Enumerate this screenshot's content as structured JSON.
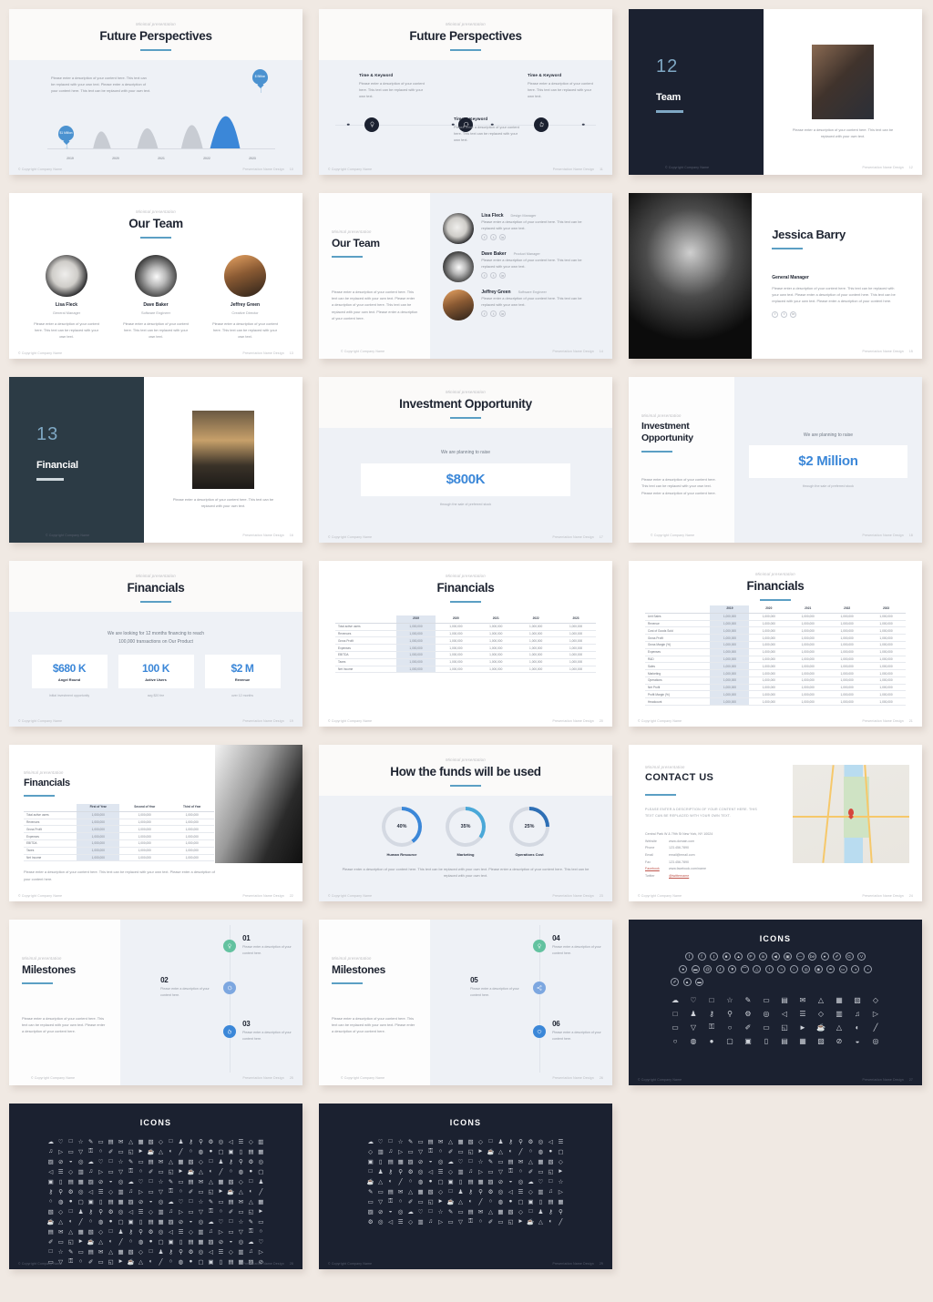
{
  "common": {
    "eyebrow": "Minimal presentation",
    "copyright": "© Copyright Company Name",
    "footer_right": "Presentation Name Design",
    "lorem_short": "Please enter a description of your content here. This text can be replaced with your own text.",
    "lorem_long": "Please enter a description of your content here. This text can be replaced with your own text. Please enter a description of your content here. This text can be replaced with your own text.",
    "lorem_xl": "Please enter a description of your content here. This text can be replaced with your own text. Please enter a description of your content here. This text can be replaced with your own text. Please enter a description of your content here."
  },
  "slides": [
    {
      "id": "future-perspectives-chart",
      "eyebrow": "Minimal presentation",
      "title": "Future Perspectives",
      "desc": "Please enter a description of your content here. This text can be replaced with your own text. Please enter a description of your content here. This text can be replaced with your own text.",
      "page": "10"
    },
    {
      "id": "future-perspectives-timeline",
      "eyebrow": "Minimal presentation",
      "title": "Future Perspectives",
      "items": [
        {
          "heading": "Time & Keyword",
          "text": "Please enter a description of your content here. This text can be replaced with your own text.",
          "icon": "lightbulb-icon",
          "glyph": "☀"
        },
        {
          "heading": "Time & Keyword",
          "text": "Please enter a description of your content here. This text can be replaced with your own text.",
          "icon": "chat-bubble-icon",
          "glyph": "●"
        },
        {
          "heading": "Time & Keyword",
          "text": "Please enter a description of your content here. This text can be replaced with your own text.",
          "icon": "thumbs-up-icon",
          "glyph": "☝"
        }
      ],
      "page": "11"
    },
    {
      "id": "section-team",
      "number": "12",
      "title": "Team",
      "caption": "Please enter a description of your content here. This text can be replaced with your own text.",
      "page": "12"
    },
    {
      "id": "our-team-three-up",
      "eyebrow": "Minimal presentation",
      "title": "Our Team",
      "members": [
        {
          "name": "Lisa Fleck",
          "role": "General Manager",
          "bio": "Please enter a description of your content here. This text can be replaced with your own text."
        },
        {
          "name": "Dave Baker",
          "role": "Software Engineer",
          "bio": "Please enter a description of your content here. This text can be replaced with your own text."
        },
        {
          "name": "Jeffrey Green",
          "role": "Creative Director",
          "bio": "Please enter a description of your content here. This text can be replaced with your own text."
        }
      ],
      "page": "13"
    },
    {
      "id": "our-team-list",
      "eyebrow": "Minimal presentation",
      "title": "Our Team",
      "intro": "Please enter a description of your content here. This text can be replaced with your own text. Please enter a description of your content here. This text can be replaced with your own text. Please enter a description of your content here.",
      "members": [
        {
          "name": "Lisa Fleck",
          "role": "Design Manager",
          "bio": "Please enter a description of your content here. This text can be replaced with your own text."
        },
        {
          "name": "Dave Baker",
          "role": "Product Manager",
          "bio": "Please enter a description of your content here. This text can be replaced with your own text."
        },
        {
          "name": "Jeffrey Green",
          "role": "Software Engineer",
          "bio": "Please enter a description of your content here. This text can be replaced with your own text."
        }
      ],
      "socials": [
        "f",
        "t",
        "in"
      ],
      "page": "14"
    },
    {
      "id": "profile-jessica-barry",
      "name": "Jessica Barry",
      "role": "General Manager",
      "bio": "Please enter a description of your content here. This text can be replaced with your own text. Please enter a description of your content here. This text can be replaced with your own text. Please enter a description of your content here.",
      "socials": [
        "f",
        "t",
        "in"
      ],
      "page": "15"
    },
    {
      "id": "section-financial",
      "number": "13",
      "title": "Financial",
      "caption": "Please enter a description of your content here. This text can be replaced with your own text.",
      "page": "16"
    },
    {
      "id": "investment-opportunity-centered",
      "eyebrow": "Minimal presentation",
      "title": "Investment Opportunity",
      "lead": "We are planning to raise",
      "amount": "$800K",
      "sub": "through the sale of preferred stock",
      "page": "17"
    },
    {
      "id": "investment-opportunity-split",
      "eyebrow": "Minimal presentation",
      "title": "Investment Opportunity",
      "intro": "Please enter a description of your content here. This text can be replaced with your own text. Please enter a description of your content here.",
      "lead": "We are planning to raise",
      "amount": "$2 Million",
      "sub": "through the sale of preferred stock",
      "page": "18"
    },
    {
      "id": "financials-kpis",
      "eyebrow": "Minimal presentation",
      "title": "Financials",
      "lead_line1": "We are looking for 12 months financing to reach",
      "lead_line2": "100,000 transactions on Our Product",
      "cards": [
        {
          "value": "$680 K",
          "label": "Angel Round",
          "sub": "Initial investment opportunity"
        },
        {
          "value": "100 K",
          "label": "Active Users",
          "sub": "avg $20 fee"
        },
        {
          "value": "$2 M",
          "label": "Revenue",
          "sub": "over 12 months"
        }
      ],
      "page": "19"
    },
    {
      "id": "financials-table-years",
      "eyebrow": "Minimal presentation",
      "title": "Financials",
      "columns": [
        "",
        "2019",
        "2020",
        "2021",
        "2022",
        "2023"
      ],
      "rows": [
        [
          "Total active users",
          "1,000,000",
          "1,000,000",
          "1,000,000",
          "1,000,000",
          "1,000,000"
        ],
        [
          "Revenues",
          "1,000,000",
          "1,000,000",
          "1,000,000",
          "1,000,000",
          "1,000,000"
        ],
        [
          "Gross Profit",
          "1,000,000",
          "1,000,000",
          "1,000,000",
          "1,000,000",
          "1,000,000"
        ],
        [
          "Expenses",
          "1,000,000",
          "1,000,000",
          "1,000,000",
          "1,000,000",
          "1,000,000"
        ],
        [
          "EBITDA",
          "1,000,000",
          "1,000,000",
          "1,000,000",
          "1,000,000",
          "1,000,000"
        ],
        [
          "Taxes",
          "1,000,000",
          "1,000,000",
          "1,000,000",
          "1,000,000",
          "1,000,000"
        ],
        [
          "Net Income",
          "1,000,000",
          "1,000,000",
          "1,000,000",
          "1,000,000",
          "1,000,000"
        ]
      ],
      "page": "20"
    },
    {
      "id": "financials-table-detailed",
      "eyebrow": "Minimal presentation",
      "title": "Financials",
      "columns": [
        "",
        "2019",
        "2020",
        "2021",
        "2022",
        "2023"
      ],
      "rows": [
        [
          "Unit Sales",
          "1,000,000",
          "1,000,000",
          "1,000,000",
          "1,000,000",
          "1,000,000"
        ],
        [
          "Revenue",
          "1,000,000",
          "1,000,000",
          "1,000,000",
          "1,000,000",
          "1,000,000"
        ],
        [
          "Cost of Goods Sold",
          "1,000,000",
          "1,000,000",
          "1,000,000",
          "1,000,000",
          "1,000,000"
        ],
        [
          "Gross Profit",
          "1,000,000",
          "1,000,000",
          "1,000,000",
          "1,000,000",
          "1,000,000"
        ],
        [
          "Gross Margin (%)",
          "1,000,000",
          "1,000,000",
          "1,000,000",
          "1,000,000",
          "1,000,000"
        ],
        [
          "Expenses",
          "1,000,000",
          "1,000,000",
          "1,000,000",
          "1,000,000",
          "1,000,000"
        ],
        [
          "R&D",
          "1,000,000",
          "1,000,000",
          "1,000,000",
          "1,000,000",
          "1,000,000"
        ],
        [
          "Sales",
          "1,000,000",
          "1,000,000",
          "1,000,000",
          "1,000,000",
          "1,000,000"
        ],
        [
          "Marketing",
          "1,000,000",
          "1,000,000",
          "1,000,000",
          "1,000,000",
          "1,000,000"
        ],
        [
          "Operations",
          "1,000,000",
          "1,000,000",
          "1,000,000",
          "1,000,000",
          "1,000,000"
        ],
        [
          "Net Profit",
          "1,000,000",
          "1,000,000",
          "1,000,000",
          "1,000,000",
          "1,000,000"
        ],
        [
          "Profit Margin (%)",
          "1,000,000",
          "1,000,000",
          "1,000,000",
          "1,000,000",
          "1,000,000"
        ],
        [
          "Headcount",
          "1,000,000",
          "1,000,000",
          "1,000,000",
          "1,000,000",
          "1,000,000"
        ]
      ],
      "page": "21"
    },
    {
      "id": "financials-table-photo",
      "eyebrow": "Minimal presentation",
      "title": "Financials",
      "columns": [
        "",
        "First of Year",
        "Second of Year",
        "Third of Year"
      ],
      "rows": [
        [
          "Total active users",
          "1,000,000",
          "1,000,000",
          "1,000,000"
        ],
        [
          "Revenues",
          "1,000,000",
          "1,000,000",
          "1,000,000"
        ],
        [
          "Gross Profit",
          "1,000,000",
          "1,000,000",
          "1,000,000"
        ],
        [
          "Expenses",
          "1,000,000",
          "1,000,000",
          "1,000,000"
        ],
        [
          "EBITDA",
          "1,000,000",
          "1,000,000",
          "1,000,000"
        ],
        [
          "Taxes",
          "1,000,000",
          "1,000,000",
          "1,000,000"
        ],
        [
          "Net Income",
          "1,000,000",
          "1,000,000",
          "1,000,000"
        ]
      ],
      "note": "Please enter a description of your content here. This text can be replaced with your own text. Please enter a description of your content here.",
      "page": "22"
    },
    {
      "id": "funds-usage",
      "eyebrow": "Minimal presentation",
      "title": "How the funds will be used",
      "note": "Please enter a description of your content here. This text can be replaced with your own text. Please enter a description of your content here. This text can be replaced with your own text.",
      "page": "23"
    },
    {
      "id": "contact-us",
      "eyebrow": "Minimal presentation",
      "title": "CONTACT US",
      "lead": "PLEASE ENTER A DESCRIPTION OF YOUR CONTENT HERE. THIS TEXT CAN BE REPLACED WITH YOUR OWN TEXT.",
      "address": "Central Park W & 79th St New York, NY 10024",
      "fields": [
        {
          "key": "Website",
          "value": "www.domain.com",
          "link": false
        },
        {
          "key": "Phone",
          "value": "123.456.7890",
          "link": false
        },
        {
          "key": "Email",
          "value": "email@email.com",
          "link": false
        },
        {
          "key": "Fax",
          "value": "123.456.7890",
          "link": false
        },
        {
          "key": "Facebook",
          "value": "www.facebook.com/name",
          "link": true
        },
        {
          "key": "Twitter",
          "value": "@twittername",
          "link": true
        }
      ],
      "page": "24"
    },
    {
      "id": "milestones-1",
      "eyebrow": "Minimal presentation",
      "title": "Milestones",
      "intro": "Please enter a description of your content here. This text can be replaced with your own text. Please enter a description of your content here.",
      "steps": [
        {
          "num": "01",
          "text": "Please enter a description of your content here.",
          "icon": "lightbulb-icon",
          "glyph": "☀",
          "color": "#63c2a0"
        },
        {
          "num": "02",
          "text": "Please enter a description of your content here.",
          "icon": "chat-bubble-icon",
          "glyph": "●",
          "color": "#7da7e0"
        },
        {
          "num": "03",
          "text": "Please enter a description of your content here.",
          "icon": "thumbs-up-icon",
          "glyph": "☝",
          "color": "#3b87d8"
        }
      ],
      "page": "25"
    },
    {
      "id": "milestones-2",
      "eyebrow": "Minimal presentation",
      "title": "Milestones",
      "intro": "Please enter a description of your content here. This text can be replaced with your own text. Please enter a description of your content here.",
      "steps": [
        {
          "num": "04",
          "text": "Please enter a description of your content here.",
          "icon": "lightbulb-icon",
          "glyph": "☀",
          "color": "#63c2a0"
        },
        {
          "num": "05",
          "text": "Please enter a description of your content here.",
          "icon": "share-icon",
          "glyph": "⌘",
          "color": "#7da7e0"
        },
        {
          "num": "06",
          "text": "Please enter a description of your content here.",
          "icon": "heart-icon",
          "glyph": "♥",
          "color": "#3b87d8"
        }
      ],
      "page": "26"
    },
    {
      "id": "icons-social",
      "title": "ICONS",
      "page": "27"
    },
    {
      "id": "icons-outline-a",
      "title": "ICONS",
      "page": "28"
    },
    {
      "id": "icons-outline-b",
      "title": "ICONS",
      "page": "29"
    }
  ],
  "chart_data": {
    "type": "area",
    "title": "Future Perspectives",
    "categories": [
      "2019",
      "2020",
      "2021",
      "2022",
      "2023"
    ],
    "values": [
      8,
      42,
      55,
      68,
      100
    ],
    "series": [
      {
        "name": "Projection",
        "values": [
          8,
          42,
          55,
          68,
          100
        ]
      }
    ],
    "annotations": [
      {
        "x": "2019",
        "label": "$1 Million",
        "color": "#4b92d0"
      },
      {
        "x": "2023",
        "label": "$ Billion",
        "color": "#4b92d0"
      }
    ],
    "xlabel": "",
    "ylabel": "",
    "ylim": [
      0,
      100
    ],
    "grid": false,
    "legend": "none",
    "highlight_color": "#3b87d8",
    "muted_color": "#c8ccd3"
  },
  "donut_chart": {
    "type": "pie",
    "title": "How the funds will be used",
    "categories": [
      "Human Resource",
      "Marketing",
      "Operations Cost"
    ],
    "values": [
      40,
      35,
      25
    ],
    "labels": [
      "40%",
      "35%",
      "25%"
    ],
    "colors": [
      "#3b87d8",
      "#4aa8d8",
      "#2e6fb5"
    ],
    "track_color": "#d4d9e2"
  },
  "icons": {
    "social_row1": [
      "f",
      "f",
      "t",
      "■",
      "▲",
      "P",
      "in",
      "◀",
      "▣",
      "—",
      "be",
      "●",
      "✐",
      "G",
      "V"
    ],
    "social_row2": [
      "●",
      "▬",
      "@",
      "J",
      "▼",
      "⌒",
      "△",
      "t",
      "≈",
      "○",
      "◎",
      "◉",
      "✒",
      "▭",
      "◑",
      "◔"
    ],
    "social_row3": [
      "✐",
      "▲",
      "▬"
    ],
    "outline_row1": [
      "☁",
      "♡",
      "□",
      "☆",
      "✎",
      "▭",
      "▤",
      "✉",
      "△",
      "▦",
      "▧",
      "◇"
    ],
    "outline_row2": [
      "□",
      "♟",
      "⚷",
      "⚲",
      "⚙",
      "◎",
      "◁",
      "☰",
      "◇",
      "▥",
      "♫",
      "▷"
    ],
    "outline_row3": [
      "▭",
      "▽",
      "⚿",
      "○",
      "✐",
      "▭",
      "◱",
      "►",
      "☕",
      "△",
      "◐",
      "╱"
    ],
    "outline_row4": [
      "○",
      "◍",
      "●",
      "▢",
      "▣",
      "▯",
      "▤",
      "▦",
      "▨",
      "⊘",
      "◒",
      "◎"
    ]
  }
}
